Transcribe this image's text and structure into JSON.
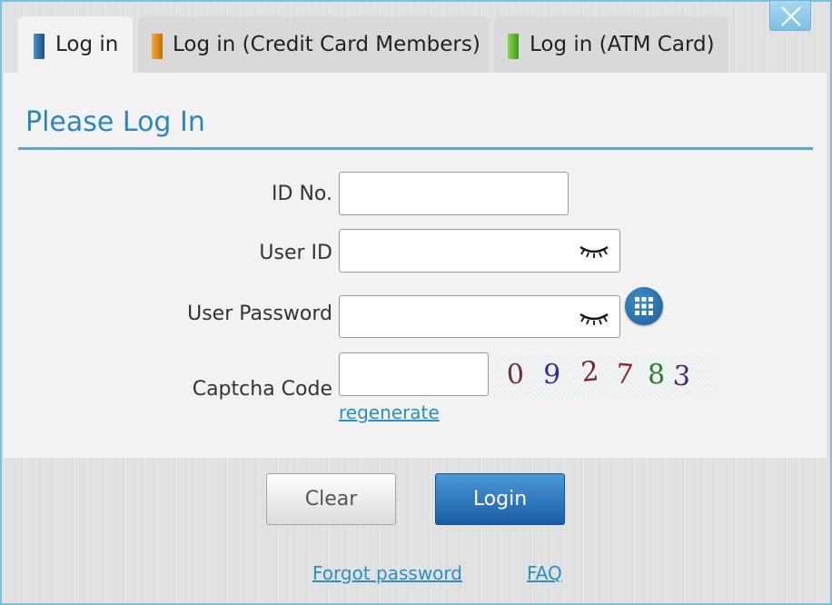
{
  "window": {
    "close_label": "close"
  },
  "tabs": [
    {
      "label": "Log in",
      "bar_color": "#1f5f98",
      "active": true
    },
    {
      "label": "Log in (Credit Card Members)",
      "bar_color": "#e08a10",
      "active": false
    },
    {
      "label": "Log in (ATM Card)",
      "bar_color": "#5cb82a",
      "active": false
    }
  ],
  "form": {
    "heading": "Please Log In",
    "id_no": {
      "label": "ID No.",
      "value": ""
    },
    "user_id": {
      "label": "User ID",
      "value": ""
    },
    "password": {
      "label": "User Password",
      "value": ""
    },
    "captcha": {
      "label": "Captcha Code",
      "value": "",
      "image_text": [
        "0",
        "9",
        "2",
        "7",
        "8",
        "3"
      ],
      "regenerate_label": "regenerate"
    }
  },
  "buttons": {
    "clear_label": "Clear",
    "login_label": "Login"
  },
  "links": {
    "forgot_password": "Forgot password",
    "faq": "FAQ"
  },
  "colors": {
    "accent": "#2f86bf",
    "login_button": "#1f5fa8",
    "frame": "#7dbfe0"
  }
}
